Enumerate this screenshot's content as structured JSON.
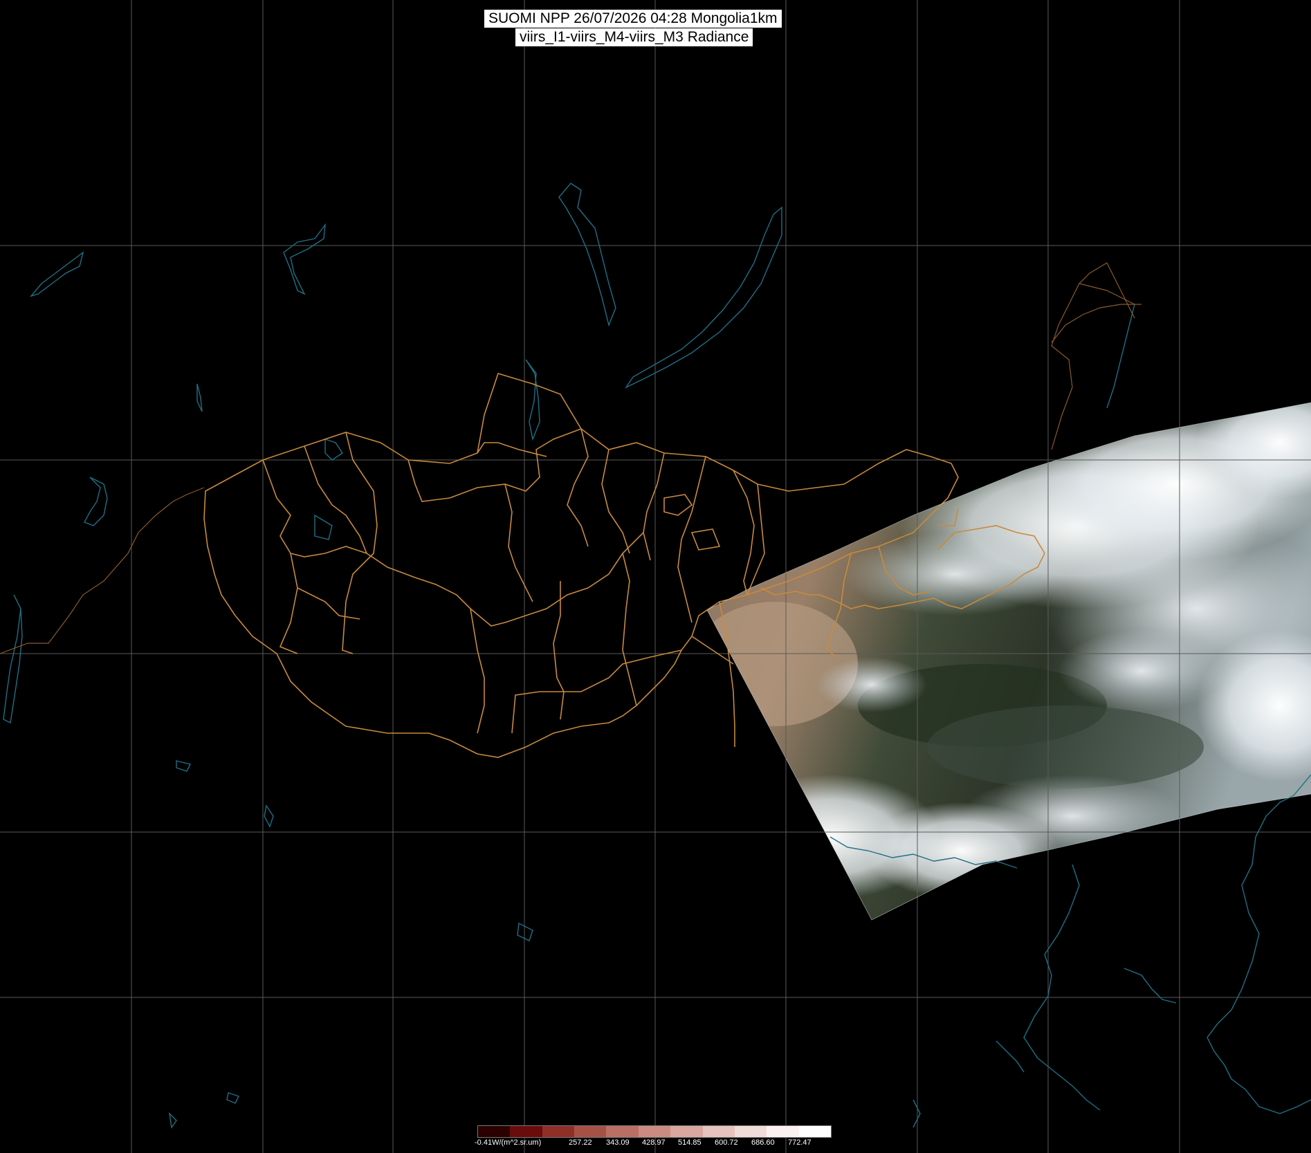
{
  "title": {
    "line1": "SUOMI NPP 26/07/2026 04:28 Mongolia1km",
    "line2": "viirs_I1-viirs_M4-viirs_M3 Radiance"
  },
  "colors": {
    "background": "#000000",
    "graticule": "#5a5a5a",
    "coastline_water": "#1f6f86",
    "province_borders": "#c98a3c",
    "country_borders": "#8a5a2a"
  },
  "legend": {
    "labels": [
      "-0.41W/(m^2.sr.um)",
      "257.22",
      "343.09",
      "428.97",
      "514.85",
      "600.72",
      "686.60",
      "772.47"
    ],
    "colors": [
      "#2a0000",
      "#6a0c0c",
      "#8f2f28",
      "#a65146",
      "#b96f64",
      "#cb8b82",
      "#d9a7a0",
      "#e6c3be",
      "#f1dcd9",
      "#fbf1f0",
      "#ffffff"
    ]
  },
  "imagery": {
    "swath": "satellite true-colour radiance swath over eastern Mongolia and north-east China"
  }
}
